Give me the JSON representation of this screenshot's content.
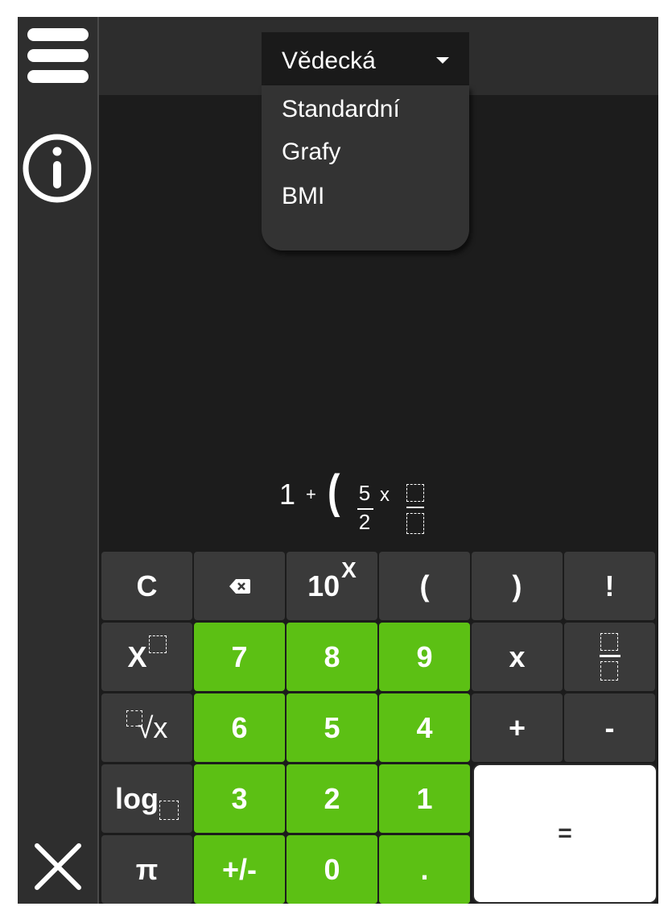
{
  "mode_dropdown": {
    "selected": "Vědecká",
    "options": [
      "Standardní",
      "Grafy",
      "BMI"
    ]
  },
  "expression": {
    "first_number": "1",
    "plus": "+",
    "open_paren": "(",
    "fraction_numerator": "5",
    "fraction_denominator": "2",
    "times": "x"
  },
  "keys": {
    "clear": "C",
    "ten_power_base": "10",
    "ten_power_exp": "X",
    "open_paren": "(",
    "close_paren": ")",
    "factorial": "!",
    "power_base": "X",
    "seven": "7",
    "eight": "8",
    "nine": "9",
    "multiply": "x",
    "root_symbol": "√x",
    "six": "6",
    "five": "5",
    "four": "4",
    "plus": "+",
    "minus": "-",
    "log": "log",
    "three": "3",
    "two": "2",
    "one": "1",
    "equals": "=",
    "pi": "π",
    "sign": "+/-",
    "zero": "0",
    "dot": "."
  },
  "colors": {
    "green_key": "#5cc014",
    "dark_key": "#3a3a3a",
    "sidebar": "#2e2e2e",
    "display": "#1c1c1c"
  },
  "icons": [
    "hamburger-menu-icon",
    "info-icon",
    "close-icon",
    "backspace-icon"
  ]
}
